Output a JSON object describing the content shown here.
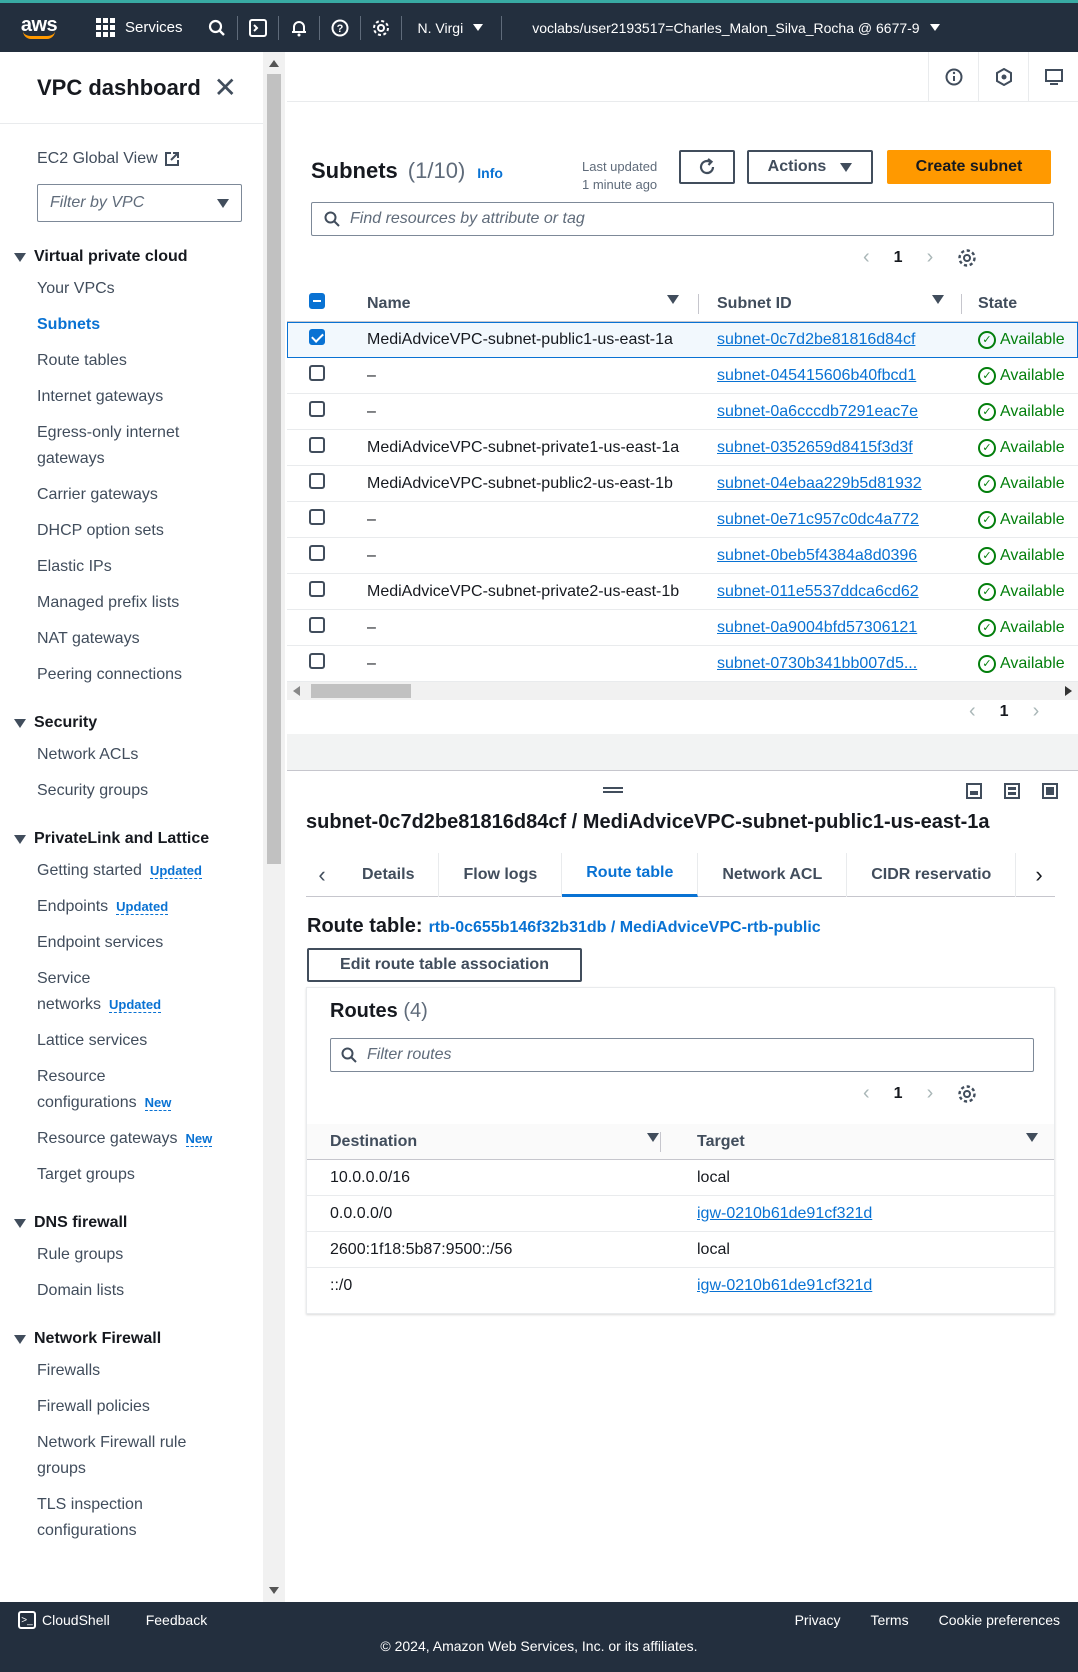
{
  "topnav": {
    "logo": "aws",
    "services": "Services",
    "region": "N. Virgi",
    "account": "voclabs/user2193517=Charles_Malon_Silva_Rocha @ 6677-9"
  },
  "sidenav": {
    "title": "VPC dashboard",
    "ec2_global": "EC2 Global View",
    "filter_placeholder": "Filter by VPC",
    "sections": [
      {
        "title": "Virtual private cloud",
        "items": [
          "Your VPCs",
          "Subnets",
          "Route tables",
          "Internet gateways",
          "Egress-only internet gateways",
          "Carrier gateways",
          "DHCP option sets",
          "Elastic IPs",
          "Managed prefix lists",
          "NAT gateways",
          "Peering connections"
        ]
      },
      {
        "title": "Security",
        "items": [
          "Network ACLs",
          "Security groups"
        ]
      },
      {
        "title": "PrivateLink and Lattice",
        "items": [
          "Getting started",
          "Endpoints",
          "Endpoint services",
          "Service networks",
          "Lattice services",
          "Resource configurations",
          "Resource gateways",
          "Target groups"
        ]
      },
      {
        "title": "DNS firewall",
        "items": [
          "Rule groups",
          "Domain lists"
        ]
      },
      {
        "title": "Network Firewall",
        "items": [
          "Firewalls",
          "Firewall policies",
          "Network Firewall rule groups",
          "TLS inspection configurations"
        ]
      }
    ],
    "badges": {
      "updated": "Updated",
      "new": "New"
    }
  },
  "subnets": {
    "title": "Subnets",
    "count": "(1/10)",
    "info": "Info",
    "last_updated_1": "Last updated",
    "last_updated_2": "1 minute ago",
    "actions": "Actions",
    "create": "Create subnet",
    "search_placeholder": "Find resources by attribute or tag",
    "page": "1",
    "columns": {
      "name": "Name",
      "id": "Subnet ID",
      "state": "State"
    },
    "rows": [
      {
        "name": "MediAdviceVPC-subnet-public1-us-east-1a",
        "id": "subnet-0c7d2be81816d84cf",
        "state": "Available",
        "selected": true
      },
      {
        "name": "–",
        "id": "subnet-045415606b40fbcd1",
        "state": "Available",
        "selected": false
      },
      {
        "name": "–",
        "id": "subnet-0a6cccdb7291eac7e",
        "state": "Available",
        "selected": false
      },
      {
        "name": "MediAdviceVPC-subnet-private1-us-east-1a",
        "id": "subnet-0352659d8415f3d3f",
        "state": "Available",
        "selected": false
      },
      {
        "name": "MediAdviceVPC-subnet-public2-us-east-1b",
        "id": "subnet-04ebaa229b5d81932",
        "state": "Available",
        "selected": false
      },
      {
        "name": "–",
        "id": "subnet-0e71c957c0dc4a772",
        "state": "Available",
        "selected": false
      },
      {
        "name": "–",
        "id": "subnet-0beb5f4384a8d0396",
        "state": "Available",
        "selected": false
      },
      {
        "name": "MediAdviceVPC-subnet-private2-us-east-1b",
        "id": "subnet-011e5537ddca6cd62",
        "state": "Available",
        "selected": false
      },
      {
        "name": "–",
        "id": "subnet-0a9004bfd57306121",
        "state": "Available",
        "selected": false
      },
      {
        "name": "–",
        "id": "subnet-0730b341bb007d5...",
        "state": "Available",
        "selected": false
      }
    ],
    "bottom_page": "1"
  },
  "detail": {
    "title": "subnet-0c7d2be81816d84cf / MediAdviceVPC-subnet-public1-us-east-1a",
    "tabs": [
      "Details",
      "Flow logs",
      "Route table",
      "Network ACL",
      "CIDR reservatio"
    ],
    "active_tab": 2,
    "route_table_label": "Route table:",
    "route_table_link": "rtb-0c655b146f32b31db / MediAdviceVPC-rtb-public",
    "edit_button": "Edit route table association",
    "routes_title": "Routes",
    "routes_count": "(4)",
    "routes_placeholder": "Filter routes",
    "routes_page": "1",
    "columns": {
      "destination": "Destination",
      "target": "Target"
    },
    "routes": [
      {
        "destination": "10.0.0.0/16",
        "target": "local",
        "link": false
      },
      {
        "destination": "0.0.0.0/0",
        "target": "igw-0210b61de91cf321d",
        "link": true
      },
      {
        "destination": "2600:1f18:5b87:9500::/56",
        "target": "local",
        "link": false
      },
      {
        "destination": "::/0",
        "target": "igw-0210b61de91cf321d",
        "link": true
      }
    ]
  },
  "footer": {
    "cloudshell": "CloudShell",
    "feedback": "Feedback",
    "privacy": "Privacy",
    "terms": "Terms",
    "cookies": "Cookie preferences",
    "copyright": "© 2024, Amazon Web Services, Inc. or its affiliates."
  },
  "colors": {
    "accent": "#0972d3",
    "primary_button": "#ff9900",
    "nav_bg": "#232f3e",
    "success": "#037f0c"
  }
}
